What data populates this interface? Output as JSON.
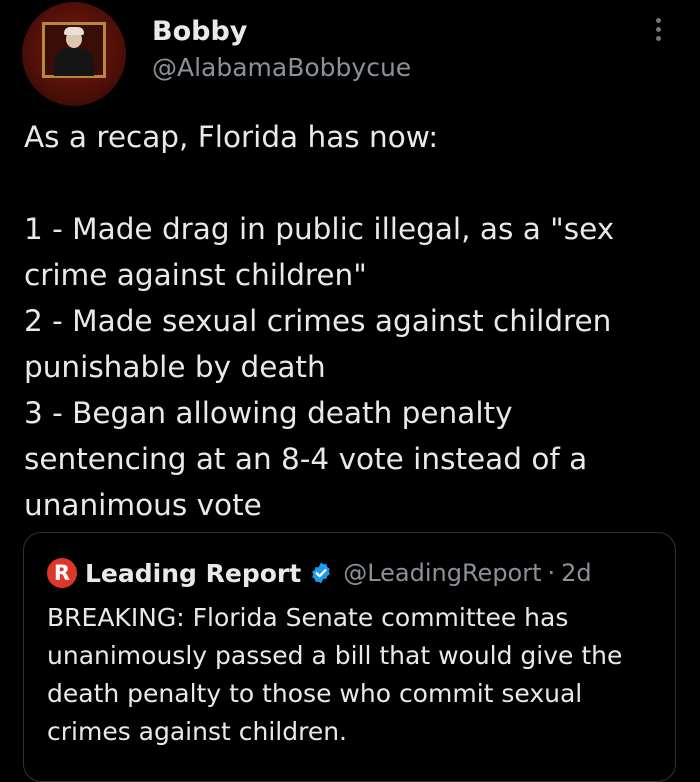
{
  "author": {
    "display_name": "Bobby",
    "handle": "@AlabamaBobbycue",
    "avatar_icon": "avatar-photo"
  },
  "tweet": {
    "text": "As a recap, Florida has now:\n\n1 - Made drag in public illegal, as a \"sex crime against children\"\n2 - Made sexual crimes against children punishable by death\n3 - Began allowing death penalty sentencing at an 8-4 vote instead of a unanimous vote"
  },
  "quoted": {
    "logo_letter": "R",
    "name": "Leading Report",
    "verified_icon": "verified-badge",
    "handle": "@LeadingReport",
    "separator": "·",
    "time": "2d",
    "text": "BREAKING: Florida Senate committee has unanimously passed a bill that would give the death penalty to those who commit sexual crimes against children."
  },
  "colors": {
    "background": "#000000",
    "text": "#e7e9ea",
    "secondary_text": "#8b9199",
    "border": "#2f3336",
    "verified": "#1d9bf0",
    "logo": "#e0362a"
  }
}
